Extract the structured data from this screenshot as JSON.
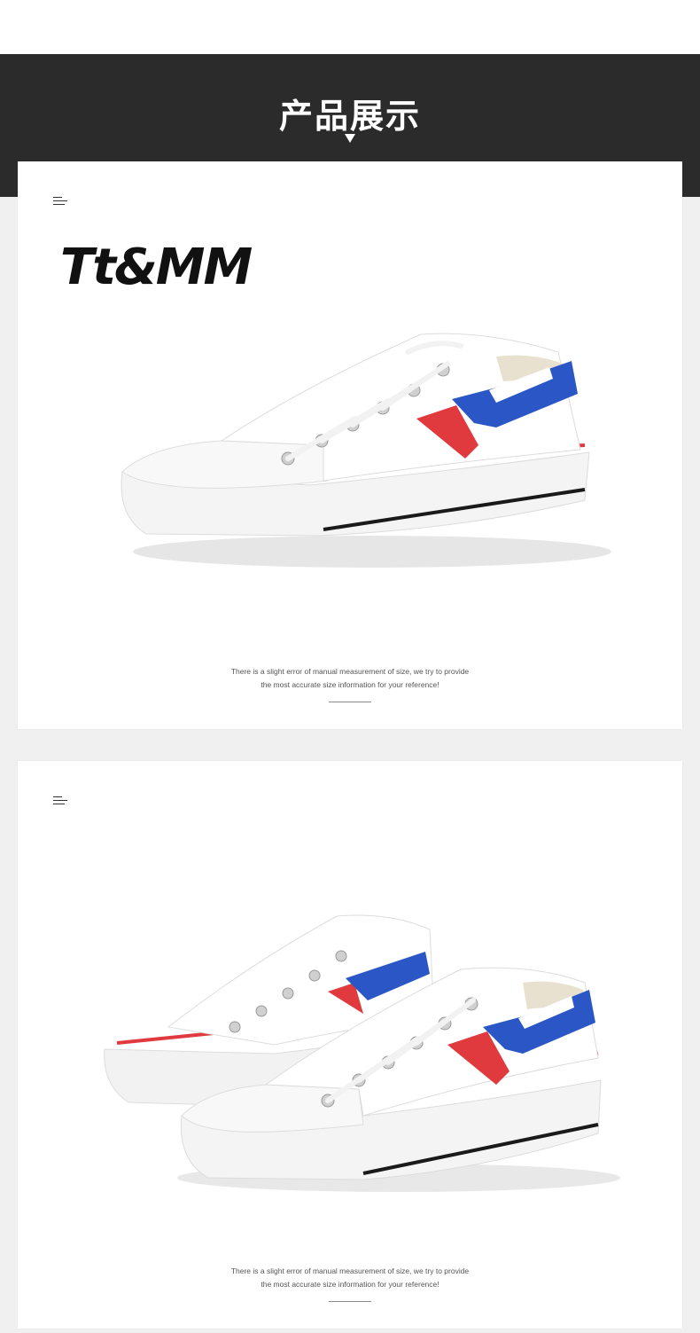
{
  "section": {
    "title": "产品展示"
  },
  "brand": {
    "logo_text": "Tt&MM"
  },
  "cards": [
    {
      "note_line1": "There is a slight error of manual measurement of size, we try to provide",
      "note_line2": "the most accurate size information for your reference!"
    },
    {
      "note_line1": "There is a slight error of manual measurement of size, we try to provide",
      "note_line2": "the most accurate size information for your reference!"
    }
  ],
  "colors": {
    "header_band": "#2b2b2b",
    "card_bg": "#ffffff",
    "page_bg": "#f0f0f0",
    "stripe_red": "#e03a3e",
    "stripe_blue": "#2a56c6",
    "sole_black": "#1a1a1a"
  }
}
